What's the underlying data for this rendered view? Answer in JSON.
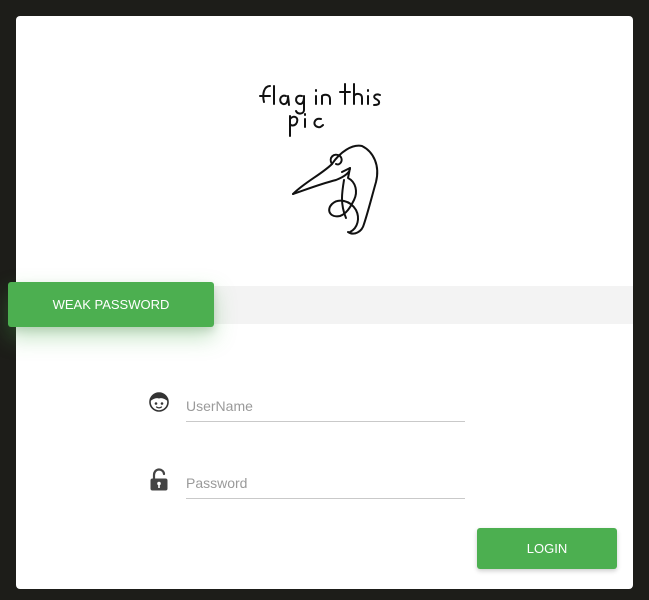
{
  "image_caption_text": "flag in this pic",
  "ribbon": {
    "label": "WEAK PASSWORD"
  },
  "form": {
    "username_placeholder": "UserName",
    "password_placeholder": "Password",
    "username_icon": "user-face-icon",
    "password_icon": "padlock-icon"
  },
  "login_button": {
    "label": "LOGIN"
  },
  "colors": {
    "accent": "#4caf50",
    "background": "#1d1d19",
    "card": "#ffffff",
    "band": "#f3f3f3"
  }
}
